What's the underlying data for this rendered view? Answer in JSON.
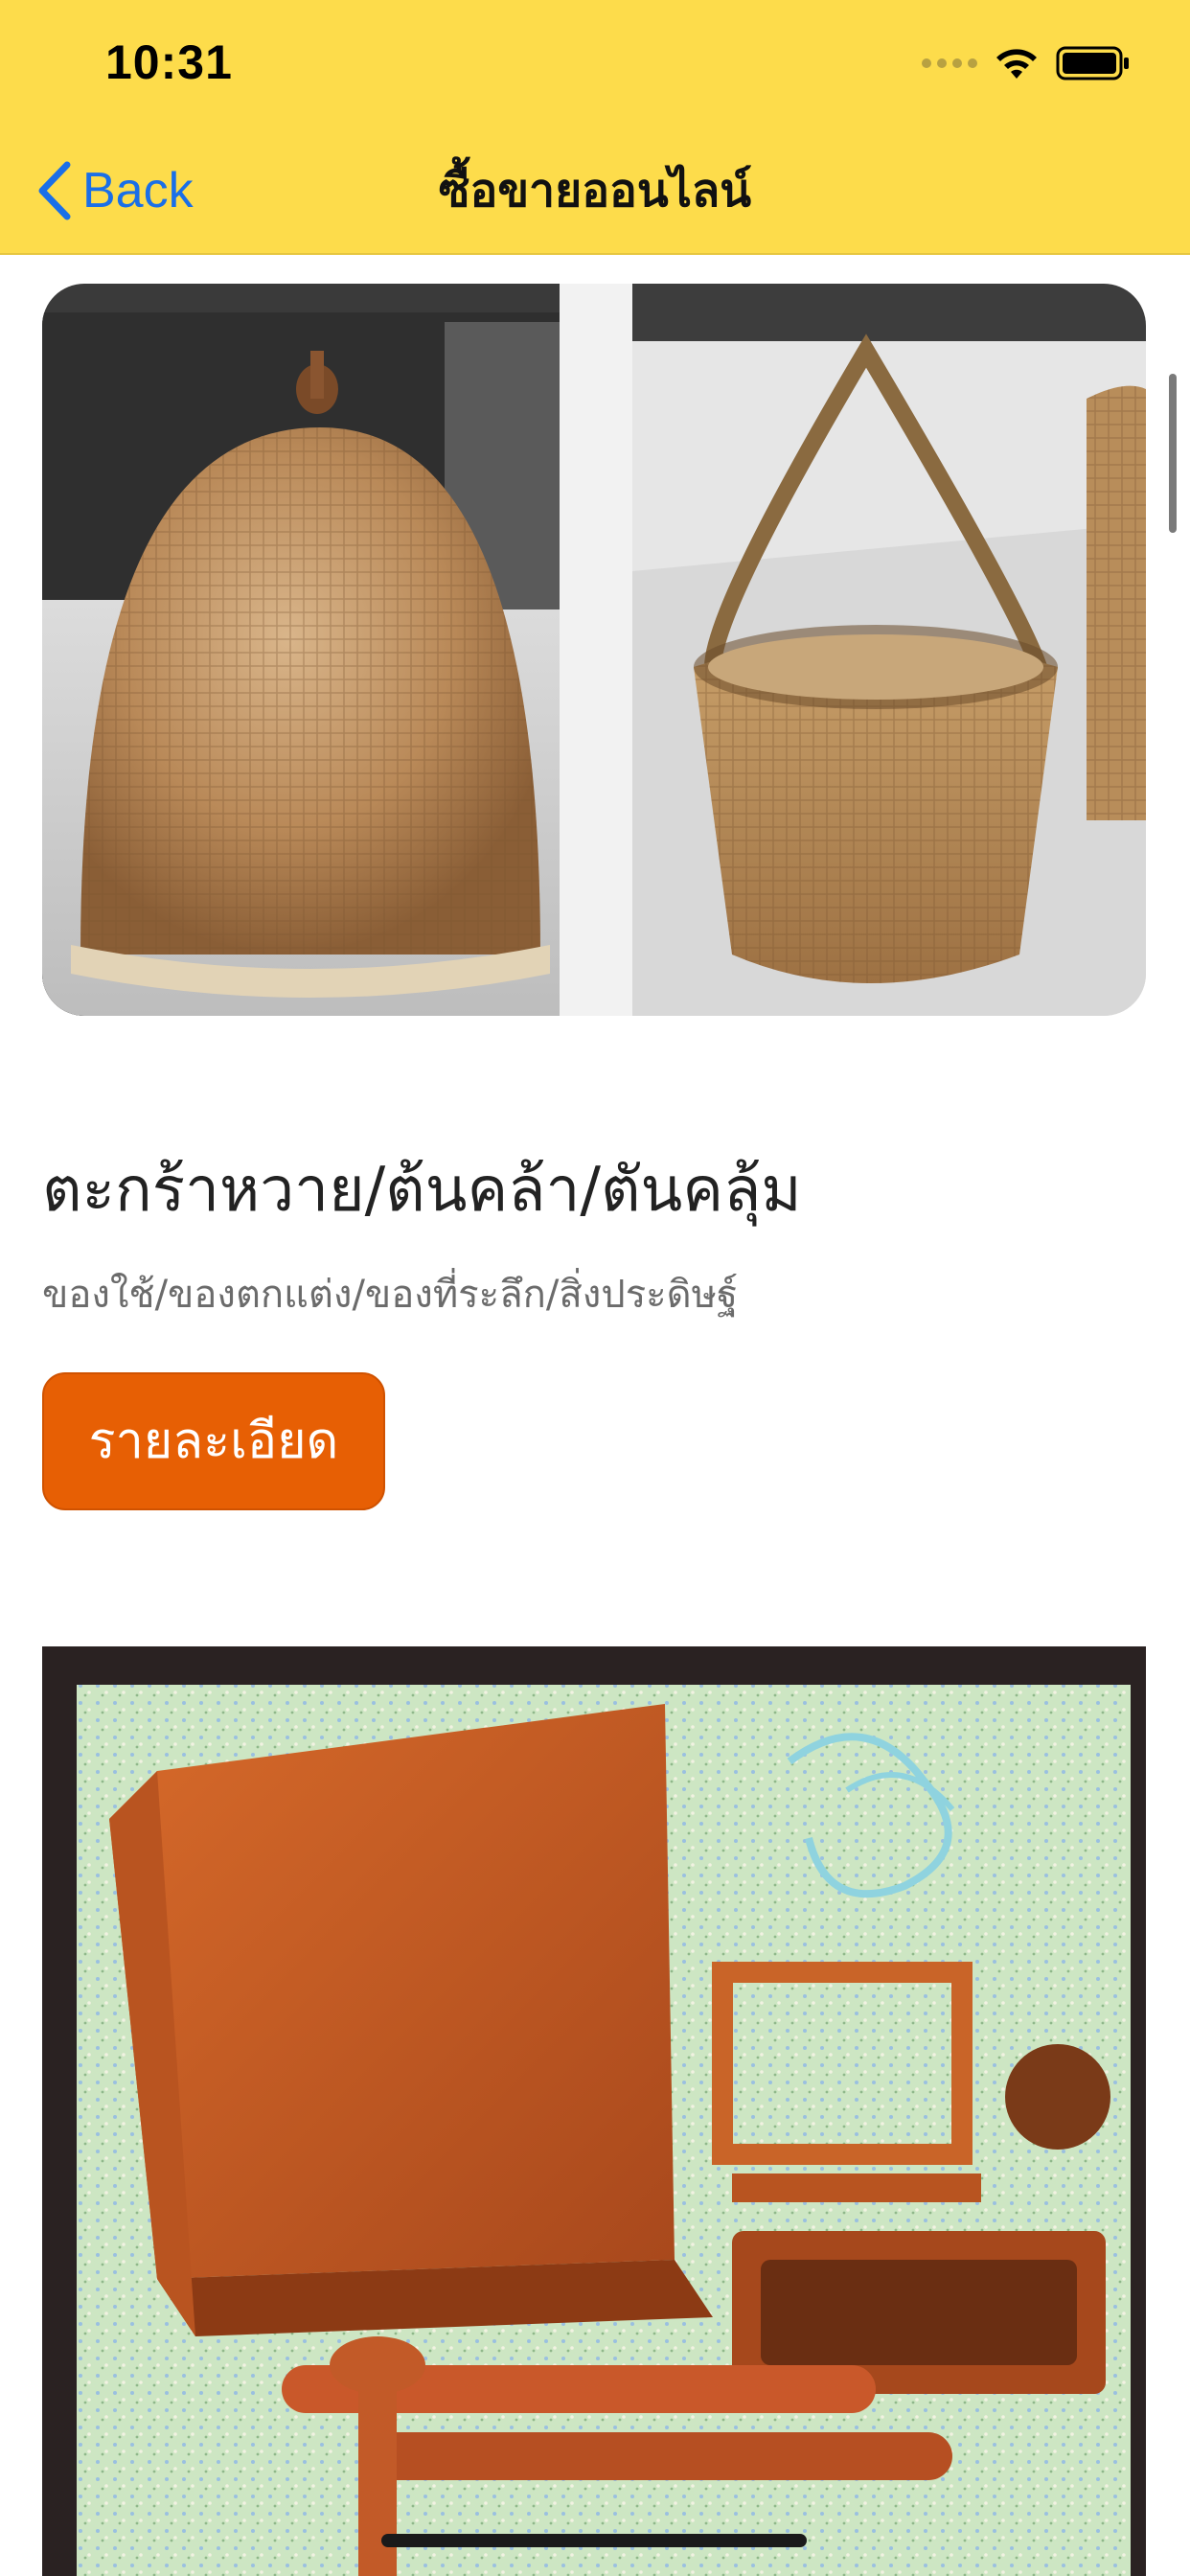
{
  "status_bar": {
    "time": "10:31"
  },
  "nav": {
    "back_label": "Back",
    "title": "ซื้อขายออนไลน์"
  },
  "products": [
    {
      "title": "ตะกร้าหวาย/ต้นคล้า/ตันคลุ้ม",
      "subtitle": "ของใช้/ของตกแต่ง/ของที่ระลึก/สิ่งประดิษฐ์",
      "button_label": "รายละเอียด"
    }
  ],
  "colors": {
    "header_bg": "#fddc4b",
    "accent_blue": "#1a6fe8",
    "button_orange": "#e75f04"
  },
  "icons": {
    "back": "chevron-left-icon",
    "wifi": "wifi-icon",
    "battery": "battery-icon",
    "signal": "signal-icon"
  }
}
